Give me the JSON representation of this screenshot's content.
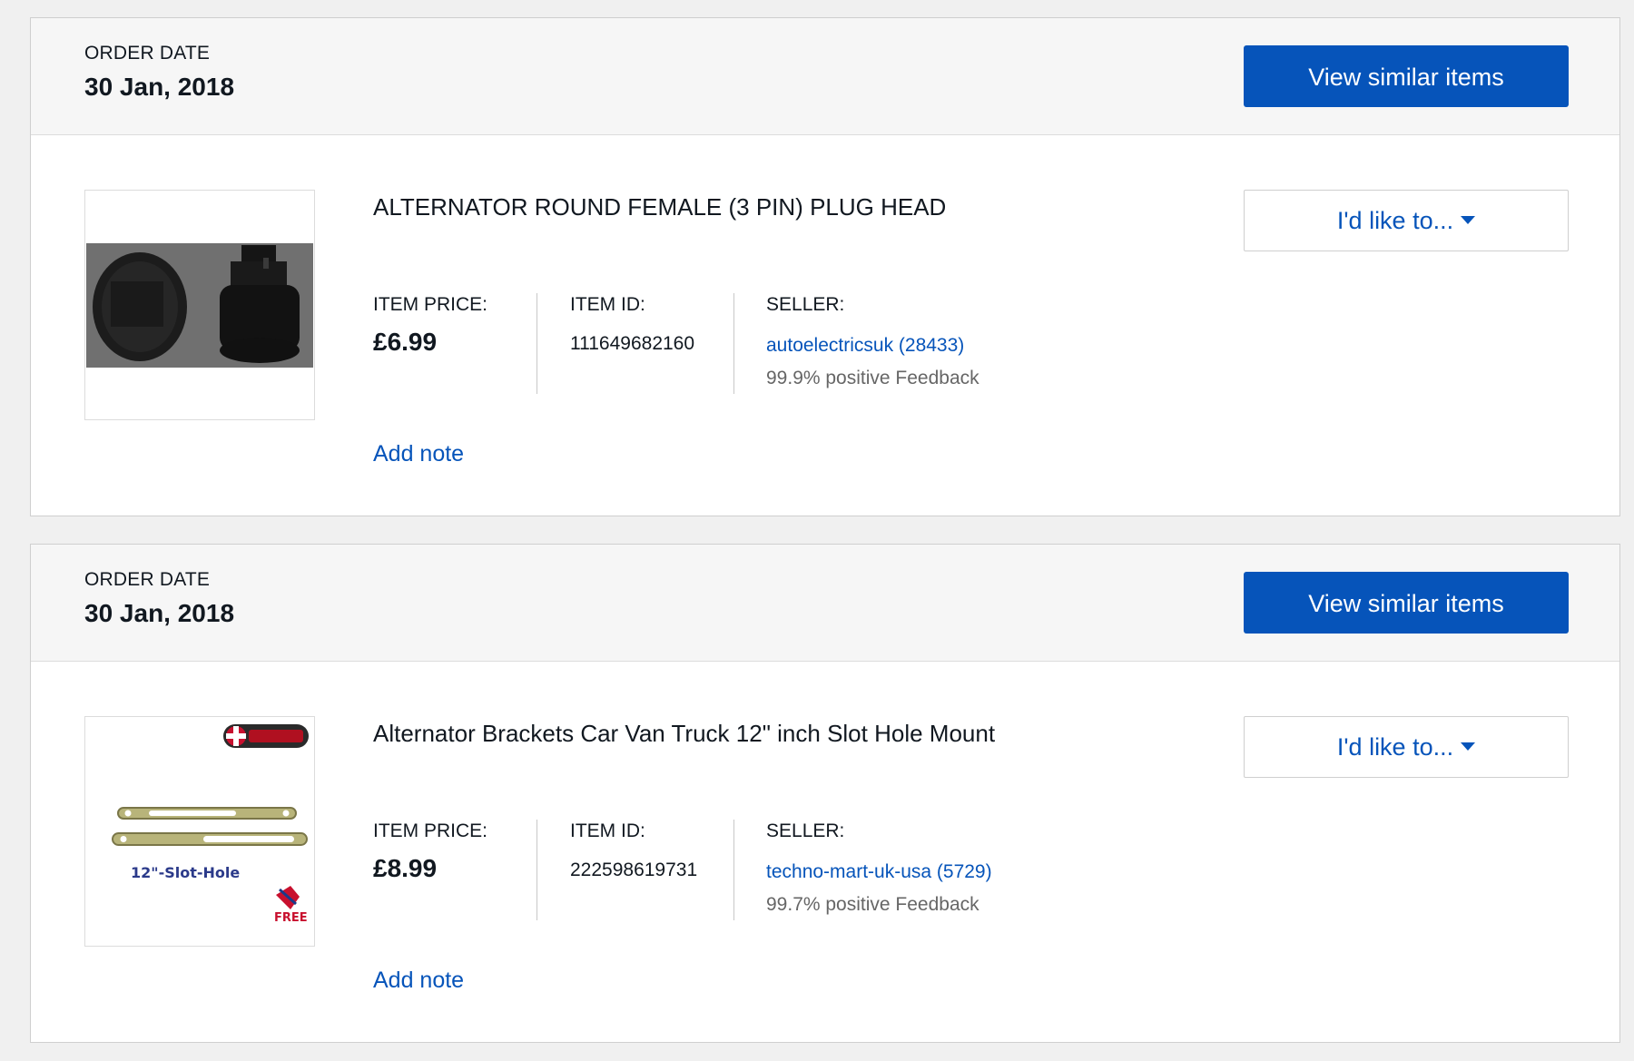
{
  "orders": [
    {
      "order_date_label": "ORDER DATE",
      "order_date": "30 Jan, 2018",
      "view_similar_label": "View similar items",
      "item": {
        "title": "ALTERNATOR ROUND FEMALE (3 PIN) PLUG HEAD",
        "price_label": "ITEM PRICE:",
        "price": "£6.99",
        "id_label": "ITEM ID:",
        "id": "111649682160",
        "seller_label": "SELLER:",
        "seller": "autoelectricsuk (28433)",
        "feedback": "99.9% positive Feedback",
        "add_note_label": "Add note",
        "action_label": "I'd like to...",
        "thumbnail_icon": "plug-head-photo"
      }
    },
    {
      "order_date_label": "ORDER DATE",
      "order_date": "30 Jan, 2018",
      "view_similar_label": "View similar items",
      "item": {
        "title": "Alternator Brackets Car Van Truck 12\" inch Slot Hole Mount",
        "price_label": "ITEM PRICE:",
        "price": "£8.99",
        "id_label": "ITEM ID:",
        "id": "222598619731",
        "seller_label": "SELLER:",
        "seller": "techno-mart-uk-usa (5729)",
        "feedback": "99.7% positive Feedback",
        "add_note_label": "Add note",
        "action_label": "I'd like to...",
        "thumbnail_icon": "bracket-photo",
        "thumbnail_caption": "12\"-Slot-Hole",
        "thumbnail_badge": "FREE"
      }
    }
  ],
  "colors": {
    "accent": "#0654ba",
    "text": "#111820",
    "muted": "#666666",
    "header_bg": "#f6f6f6"
  }
}
